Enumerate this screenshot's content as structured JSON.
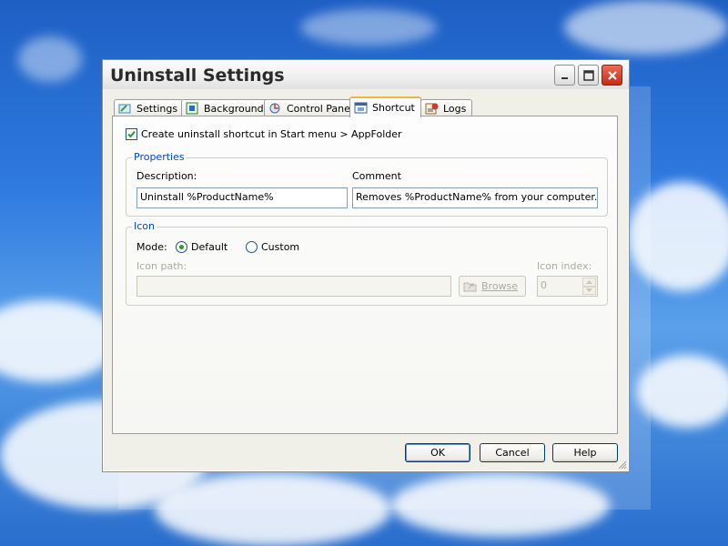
{
  "window": {
    "title": "Uninstall Settings"
  },
  "tabs": [
    {
      "label": "Settings",
      "icon": "settings-icon",
      "active": false
    },
    {
      "label": "Background",
      "icon": "background-icon",
      "active": false
    },
    {
      "label": "Control Panel",
      "icon": "control-panel-icon",
      "active": false
    },
    {
      "label": "Shortcut",
      "icon": "shortcut-icon",
      "active": true
    },
    {
      "label": "Logs",
      "icon": "logs-icon",
      "active": false
    }
  ],
  "shortcut": {
    "create_label": "Create uninstall shortcut in Start menu > AppFolder",
    "create_checked": true,
    "properties": {
      "legend": "Properties",
      "description_label": "Description:",
      "description_value": "Uninstall %ProductName%",
      "comment_label": "Comment",
      "comment_value": "Removes %ProductName% from your computer."
    },
    "icon": {
      "legend": "Icon",
      "mode_label": "Mode:",
      "default_label": "Default",
      "custom_label": "Custom",
      "selected_mode": "Default",
      "path_label": "Icon path:",
      "path_value": "",
      "browse_label": "Browse",
      "index_label": "Icon index:",
      "index_value": "0"
    }
  },
  "buttons": {
    "ok": "OK",
    "cancel": "Cancel",
    "help": "Help"
  },
  "colors": {
    "accent_tab": "#f5b43b",
    "group_legend": "#0046d5",
    "close_button": "#c42b15"
  }
}
